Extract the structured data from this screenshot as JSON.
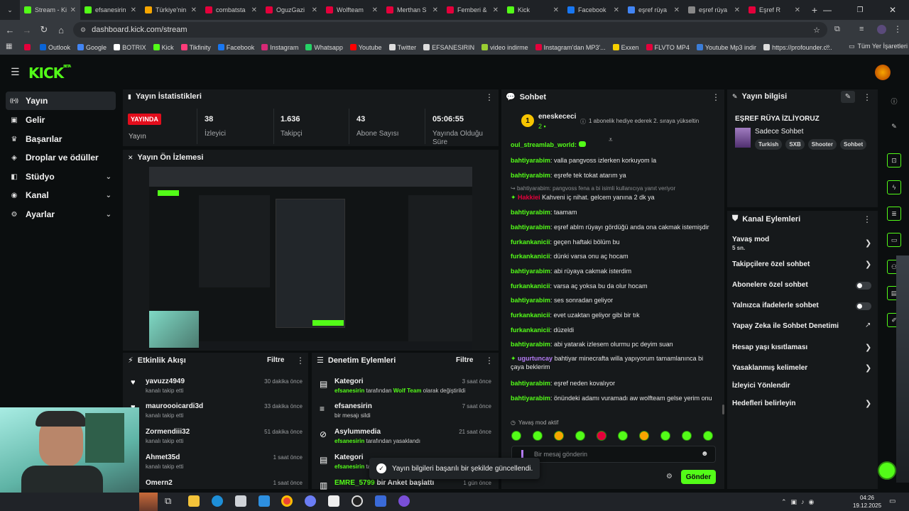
{
  "browser": {
    "tabs": [
      {
        "title": "Stream - Kick",
        "color": "#53fc18"
      },
      {
        "title": "efsanesirin",
        "color": "#53fc18"
      },
      {
        "title": "Türkiye'nin",
        "color": "#f7a600"
      },
      {
        "title": "combatsta",
        "color": "#e4003b"
      },
      {
        "title": "OguzGazi",
        "color": "#e4003b"
      },
      {
        "title": "Wolfteam",
        "color": "#e4003b"
      },
      {
        "title": "Merthan S",
        "color": "#e4003b"
      },
      {
        "title": "Femberi &",
        "color": "#e4003b"
      },
      {
        "title": "Kick",
        "color": "#53fc18"
      },
      {
        "title": "Facebook",
        "color": "#1877f2"
      },
      {
        "title": "eşref rüya",
        "color": "#4285f4"
      },
      {
        "title": "eşref rüya",
        "color": "#888888"
      },
      {
        "title": "Eşref R",
        "color": "#e4003b"
      }
    ],
    "url": "dashboard.kick.com/stream",
    "bookmarks": [
      {
        "label": "",
        "color": "#e4003b"
      },
      {
        "label": "Outlook",
        "color": "#0a64d6"
      },
      {
        "label": "Google",
        "color": "#4285f4"
      },
      {
        "label": "BOTRIX",
        "color": "#ffffff"
      },
      {
        "label": "Kick",
        "color": "#53fc18"
      },
      {
        "label": "Tikfinity",
        "color": "#ff3c7a"
      },
      {
        "label": "Facebook",
        "color": "#1877f2"
      },
      {
        "label": "Instagram",
        "color": "#d62976"
      },
      {
        "label": "Whatsapp",
        "color": "#25d366"
      },
      {
        "label": "Youtube",
        "color": "#ff0000"
      },
      {
        "label": "Twitter",
        "color": "#dddddd"
      },
      {
        "label": "EFSANESIRIN",
        "color": "#dddddd"
      },
      {
        "label": "video indirme",
        "color": "#9acd32"
      },
      {
        "label": "Instagram'dan MP3'...",
        "color": "#e4003b"
      },
      {
        "label": "Exxen",
        "color": "#f7d000"
      },
      {
        "label": "FLVTO MP4",
        "color": "#e4003b"
      },
      {
        "label": "Youtube Mp3 indir",
        "color": "#3b7dd8"
      },
      {
        "label": "https://profounder.c...",
        "color": "#dddddd"
      }
    ],
    "all_bookmarks": "Tüm Yer İşaretleri"
  },
  "sidebar": {
    "items": [
      {
        "label": "Yayın",
        "icon": "broadcast-icon"
      },
      {
        "label": "Gelir",
        "icon": "money-icon"
      },
      {
        "label": "Başarılar",
        "icon": "trophy-icon"
      },
      {
        "label": "Droplar ve ödüller",
        "icon": "gift-icon"
      },
      {
        "label": "Stüdyo",
        "icon": "studio-icon"
      },
      {
        "label": "Kanal",
        "icon": "channel-icon"
      },
      {
        "label": "Ayarlar",
        "icon": "settings-icon"
      }
    ]
  },
  "stats": {
    "title": "Yayın İstatistikleri",
    "live_badge": "YAYINDA",
    "live_label": "Yayın",
    "viewers": {
      "value": "38",
      "label": "İzleyici"
    },
    "followers": {
      "value": "1.636",
      "label": "Takipçi"
    },
    "subs": {
      "value": "43",
      "label": "Abone Sayısı"
    },
    "uptime": {
      "value": "05:06:55",
      "label": "Yayında Olduğu Süre"
    }
  },
  "preview": {
    "title": "Yayın Ön İzlemesi"
  },
  "activity": {
    "title": "Etkinlik Akışı",
    "filter": "Filtre",
    "rows": [
      {
        "name": "yavuzz4949",
        "sub": "kanalı takip etti",
        "time": "30 dakika önce"
      },
      {
        "name": "mauroooicardi3d",
        "sub": "kanalı takip etti",
        "time": "33 dakika önce"
      },
      {
        "name": "Zormendiii32",
        "sub": "kanalı takip etti",
        "time": "51 dakika önce"
      },
      {
        "name": "Ahmet35d",
        "sub": "kanalı takip etti",
        "time": "1 saat önce"
      },
      {
        "name": "Omern2",
        "sub": "",
        "time": "1 saat önce"
      }
    ]
  },
  "moderation": {
    "title": "Denetim Eylemleri",
    "filter": "Filtre",
    "rows": [
      {
        "name": "Kategori",
        "user": "efsanesirin",
        "mid": " tarafından ",
        "hl": "Wolf Team",
        "tail": " olarak değiştirildi",
        "time": "3 saat önce"
      },
      {
        "name": "efsanesirin",
        "user": "",
        "mid": "bir mesajı sildi",
        "hl": "",
        "tail": "",
        "time": "7 saat önce"
      },
      {
        "name": "Asylummedia",
        "user": "efsanesirin",
        "mid": " tarafından yasaklandı",
        "hl": "",
        "tail": "",
        "time": "21 saat önce"
      },
      {
        "name": "Kategori",
        "user": "efsanesirin",
        "mid": " ta",
        "hl": "",
        "tail": "",
        "time": ""
      },
      {
        "name": "EMRE_5799",
        "user": "",
        "mid": " bir Anket başlattı",
        "hl": "",
        "tail": "",
        "time": "1 gün önce"
      }
    ]
  },
  "chat": {
    "title": "Sohbet",
    "pinned_user": "eneskececi",
    "pinned_rank": "1",
    "pinned_count": "2",
    "pinned_msg": "1 abonelik hediye ederek 2. sıraya yükseltin",
    "cut_user": "oul_streamlab_world:",
    "messages": [
      {
        "user": "bahtiyarabim",
        "text": "valla pangvoss izlerken korkuyom la"
      },
      {
        "user": "bahtiyarabim",
        "text": "eşrefe tek tokat atarım ya"
      },
      {
        "user": "",
        "text": "bahtiyarabim: pangvoss fena a bi isimli kullanıcıya yanıt veriyor",
        "reply": true
      },
      {
        "user": "Hakkiei",
        "text": "Kahveni iç nihat. gelcem yanına 2 dk ya",
        "red": true
      },
      {
        "user": "bahtiyarabim",
        "text": "taamam"
      },
      {
        "user": "bahtiyarabim",
        "text": "eşref ablm rüyayı gördüğü anda ona cakmak istemişdir"
      },
      {
        "user": "furkankanicii",
        "text": "geçen haftaki bölüm bu"
      },
      {
        "user": "furkankanicii",
        "text": "dünki varsa onu aç hocam"
      },
      {
        "user": "bahtiyarabim",
        "text": "abi rüyaya cakmak isterdim"
      },
      {
        "user": "furkankanicii",
        "text": "varsa aç yoksa bu da olur hocam"
      },
      {
        "user": "bahtiyarabim",
        "text": "ses sonradan geliyor"
      },
      {
        "user": "furkankanicii",
        "text": "evet uzaktan geliyor gibi bir tık"
      },
      {
        "user": "furkankanicii",
        "text": "düzeldi"
      },
      {
        "user": "bahtiyarabim",
        "text": "abi yatarak izlesem olurmu pc deyim suan"
      },
      {
        "user": "ugurtuncay",
        "text": "bahtiyar minecrafta willa yapıyorum tamamlanınca bi çaya beklerim",
        "purple": true
      },
      {
        "user": "bahtiyarabim",
        "text": "eşref neden kovalıyor"
      },
      {
        "user": "bahtiyarabim",
        "text": "önündeki adamı vuramadı aw wolfteam gelse yerim onu"
      }
    ],
    "slow_mode": "Yavaş mod aktif",
    "placeholder": "Bir mesaj gönderin",
    "send": "Gönder"
  },
  "info": {
    "title": "Yayın bilgisi",
    "stream_title": "EŞREF RÜYA İZLİYORUZ",
    "category": "Sadece Sohbet",
    "tags": [
      "Turkish",
      "SXB",
      "Shooter",
      "Sohbet"
    ]
  },
  "channel_actions": {
    "title": "Kanal Eylemleri",
    "slow_mode": "Yavaş mod",
    "slow_mode_value": "5 sn.",
    "items": [
      {
        "label": "Takipçilere özel sohbet",
        "type": "chevron"
      },
      {
        "label": "Abonelere özel sohbet",
        "type": "toggle"
      },
      {
        "label": "Yalnızca ifadelerle sohbet",
        "type": "toggle"
      },
      {
        "label": "Yapay Zeka ile Sohbet Denetimi",
        "type": "external"
      },
      {
        "label": "Hesap yaşı kısıtlaması",
        "type": "chevron"
      },
      {
        "label": "Yasaklanmış kelimeler",
        "type": "chevron"
      },
      {
        "label": "İzleyici Yönlendir",
        "type": "none"
      },
      {
        "label": "Hedefleri belirleyin",
        "type": "chevron"
      }
    ]
  },
  "toast": "Yayın bilgileri başarılı bir şekilde güncellendi.",
  "clock": {
    "time": "04:26",
    "date": "19.12.2025"
  }
}
